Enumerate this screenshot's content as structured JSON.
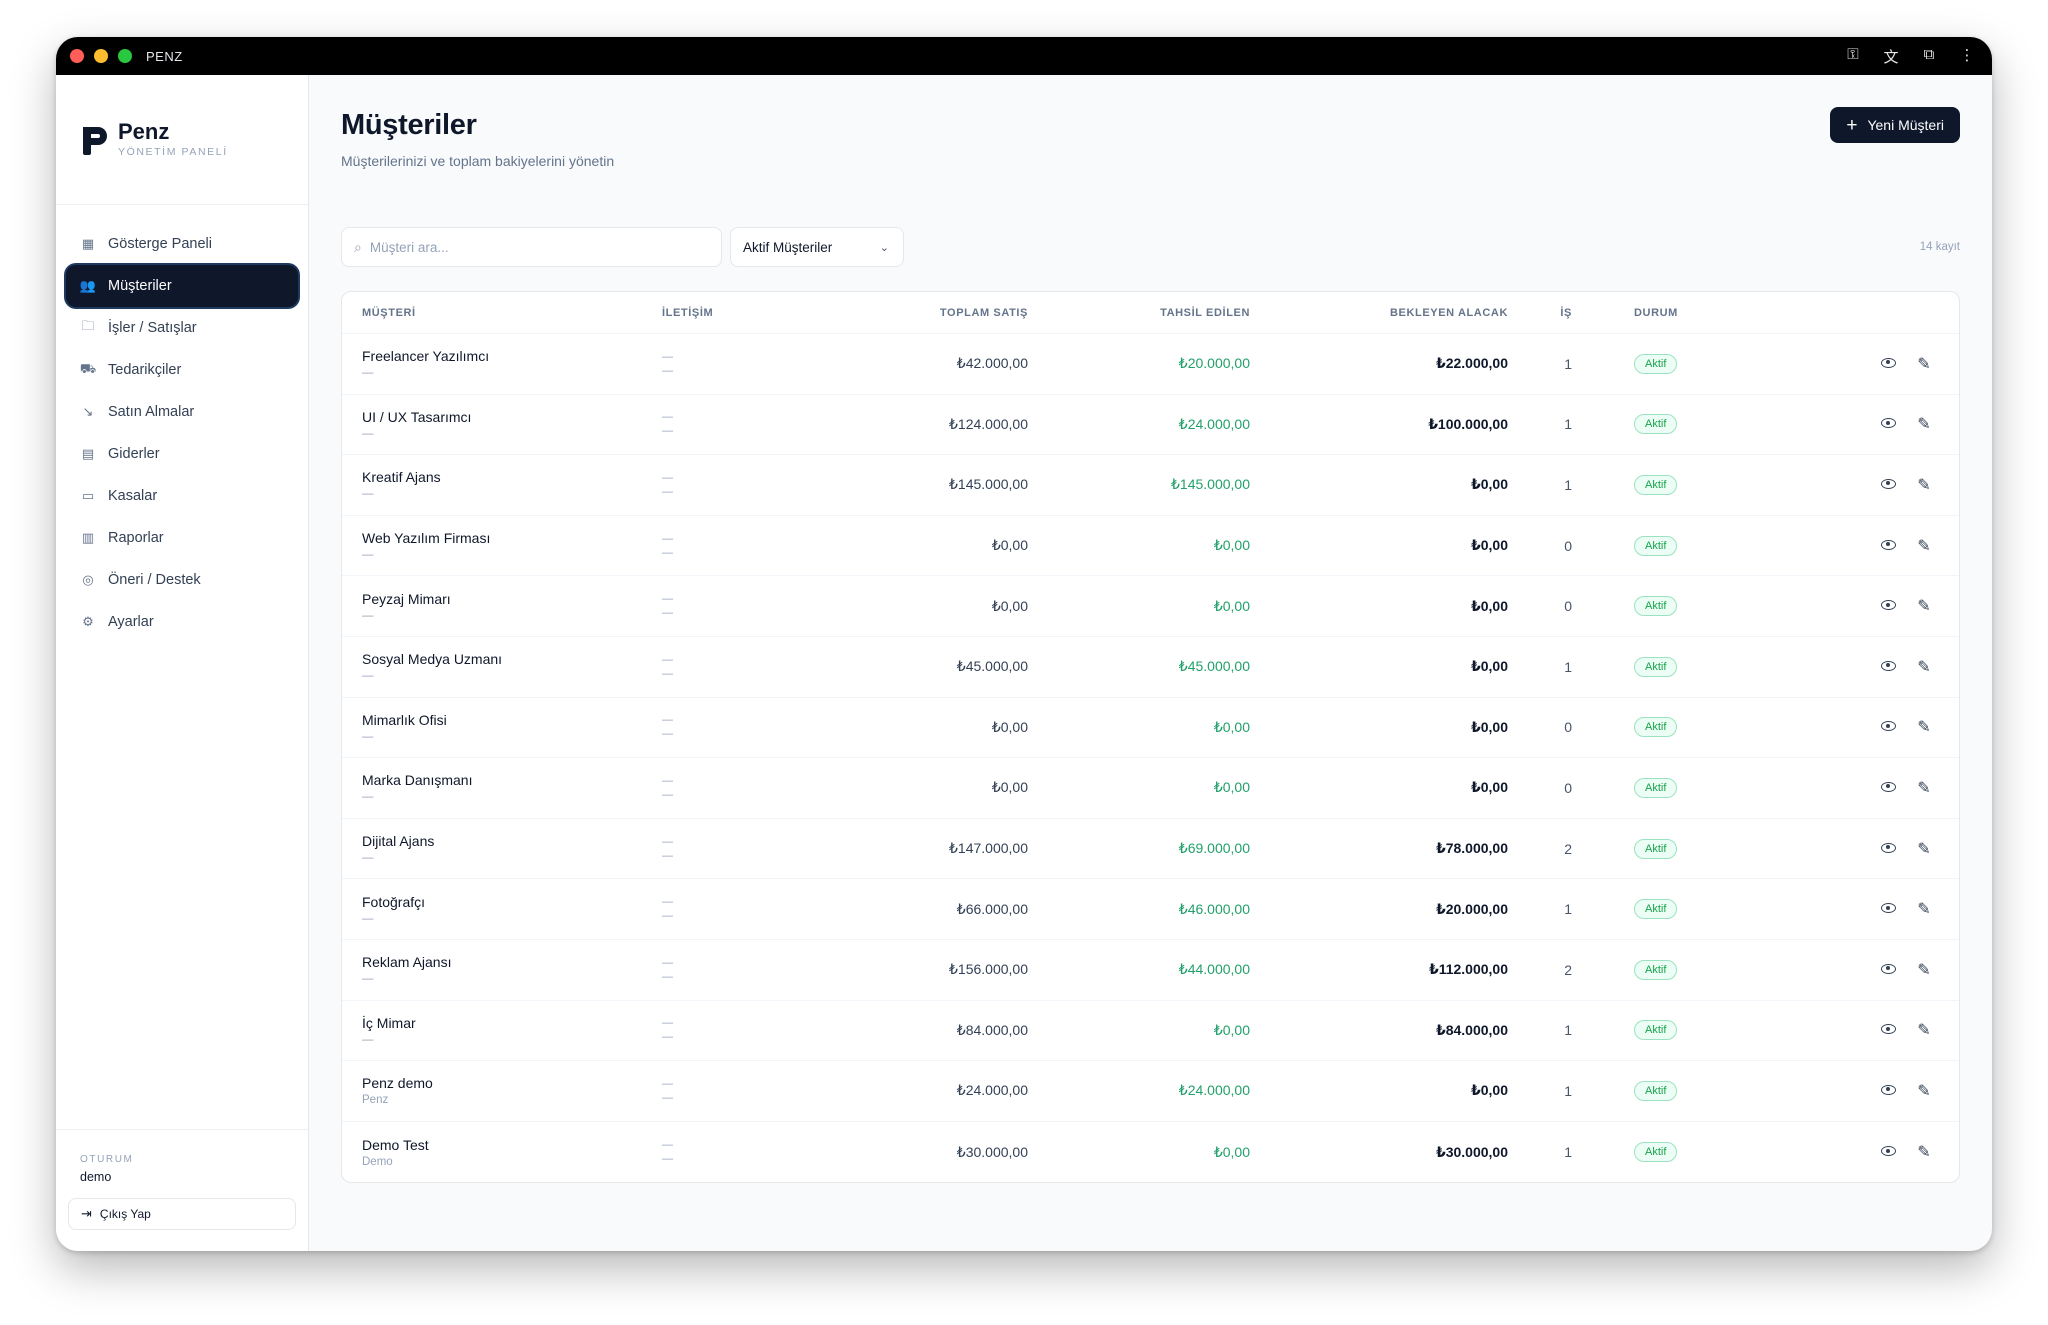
{
  "window": {
    "title": "PENZ"
  },
  "brand": {
    "name": "Penz",
    "subtitle": "YÖNETİM PANELİ"
  },
  "sidebar": {
    "items": [
      {
        "label": "Gösterge Paneli",
        "icon": "grid-icon",
        "glyph": "▦",
        "active": false
      },
      {
        "label": "Müşteriler",
        "icon": "users-icon",
        "glyph": "👥",
        "active": true
      },
      {
        "label": "İşler / Satışlar",
        "icon": "folder-icon",
        "glyph": "🗀",
        "active": false
      },
      {
        "label": "Tedarikçiler",
        "icon": "truck-icon",
        "glyph": "⛟",
        "active": false
      },
      {
        "label": "Satın Almalar",
        "icon": "trend-down-icon",
        "glyph": "↘",
        "active": false
      },
      {
        "label": "Giderler",
        "icon": "receipt-icon",
        "glyph": "▤",
        "active": false
      },
      {
        "label": "Kasalar",
        "icon": "wallet-icon",
        "glyph": "▭",
        "active": false
      },
      {
        "label": "Raporlar",
        "icon": "bar-chart-icon",
        "glyph": "▥",
        "active": false
      },
      {
        "label": "Öneri / Destek",
        "icon": "lifebuoy-icon",
        "glyph": "◎",
        "active": false
      },
      {
        "label": "Ayarlar",
        "icon": "gear-icon",
        "glyph": "⚙",
        "active": false
      }
    ],
    "session_label": "OTURUM",
    "session_user": "demo",
    "logout_label": "Çıkış Yap"
  },
  "header": {
    "title": "Müşteriler",
    "subtitle": "Müşterilerinizi ve toplam bakiyelerini yönetin",
    "new_button": "Yeni Müşteri"
  },
  "toolbar": {
    "search_placeholder": "Müşteri ara...",
    "filter_value": "Aktif Müşteriler",
    "count": "14 kayıt"
  },
  "table": {
    "columns": {
      "name": "MÜŞTERİ",
      "contact": "İLETİŞİM",
      "total": "TOPLAM SATIŞ",
      "paid": "TAHSİL EDİLEN",
      "pending": "BEKLEYEN ALACAK",
      "jobs": "İŞ",
      "status": "DURUM"
    },
    "rows": [
      {
        "name": "Freelancer Yazılımcı",
        "sub": "—",
        "c1": "—",
        "c2": "—",
        "total": "₺42.000,00",
        "paid": "₺20.000,00",
        "pending": "₺22.000,00",
        "jobs": "1",
        "status": "Aktif"
      },
      {
        "name": "UI / UX Tasarımcı",
        "sub": "—",
        "c1": "—",
        "c2": "—",
        "total": "₺124.000,00",
        "paid": "₺24.000,00",
        "pending": "₺100.000,00",
        "jobs": "1",
        "status": "Aktif"
      },
      {
        "name": "Kreatif Ajans",
        "sub": "—",
        "c1": "—",
        "c2": "—",
        "total": "₺145.000,00",
        "paid": "₺145.000,00",
        "pending": "₺0,00",
        "jobs": "1",
        "status": "Aktif"
      },
      {
        "name": "Web Yazılım Firması",
        "sub": "—",
        "c1": "—",
        "c2": "—",
        "total": "₺0,00",
        "paid": "₺0,00",
        "pending": "₺0,00",
        "jobs": "0",
        "status": "Aktif"
      },
      {
        "name": "Peyzaj Mimarı",
        "sub": "—",
        "c1": "—",
        "c2": "—",
        "total": "₺0,00",
        "paid": "₺0,00",
        "pending": "₺0,00",
        "jobs": "0",
        "status": "Aktif"
      },
      {
        "name": "Sosyal Medya Uzmanı",
        "sub": "—",
        "c1": "—",
        "c2": "—",
        "total": "₺45.000,00",
        "paid": "₺45.000,00",
        "pending": "₺0,00",
        "jobs": "1",
        "status": "Aktif"
      },
      {
        "name": "Mimarlık Ofisi",
        "sub": "—",
        "c1": "—",
        "c2": "—",
        "total": "₺0,00",
        "paid": "₺0,00",
        "pending": "₺0,00",
        "jobs": "0",
        "status": "Aktif"
      },
      {
        "name": "Marka Danışmanı",
        "sub": "—",
        "c1": "—",
        "c2": "—",
        "total": "₺0,00",
        "paid": "₺0,00",
        "pending": "₺0,00",
        "jobs": "0",
        "status": "Aktif"
      },
      {
        "name": "Dijital Ajans",
        "sub": "—",
        "c1": "—",
        "c2": "—",
        "total": "₺147.000,00",
        "paid": "₺69.000,00",
        "pending": "₺78.000,00",
        "jobs": "2",
        "status": "Aktif"
      },
      {
        "name": "Fotoğrafçı",
        "sub": "—",
        "c1": "—",
        "c2": "—",
        "total": "₺66.000,00",
        "paid": "₺46.000,00",
        "pending": "₺20.000,00",
        "jobs": "1",
        "status": "Aktif"
      },
      {
        "name": "Reklam Ajansı",
        "sub": "—",
        "c1": "—",
        "c2": "—",
        "total": "₺156.000,00",
        "paid": "₺44.000,00",
        "pending": "₺112.000,00",
        "jobs": "2",
        "status": "Aktif"
      },
      {
        "name": "İç Mimar",
        "sub": "—",
        "c1": "—",
        "c2": "—",
        "total": "₺84.000,00",
        "paid": "₺0,00",
        "pending": "₺84.000,00",
        "jobs": "1",
        "status": "Aktif"
      },
      {
        "name": "Penz demo",
        "sub": "Penz",
        "c1": "—",
        "c2": "—",
        "total": "₺24.000,00",
        "paid": "₺24.000,00",
        "pending": "₺0,00",
        "jobs": "1",
        "status": "Aktif"
      },
      {
        "name": "Demo Test",
        "sub": "Demo",
        "c1": "—",
        "c2": "—",
        "total": "₺30.000,00",
        "paid": "₺0,00",
        "pending": "₺30.000,00",
        "jobs": "1",
        "status": "Aktif"
      }
    ]
  },
  "colors": {
    "primary": "#0f172a",
    "paid_green": "#22a06b",
    "badge_green": "#16a34a"
  }
}
